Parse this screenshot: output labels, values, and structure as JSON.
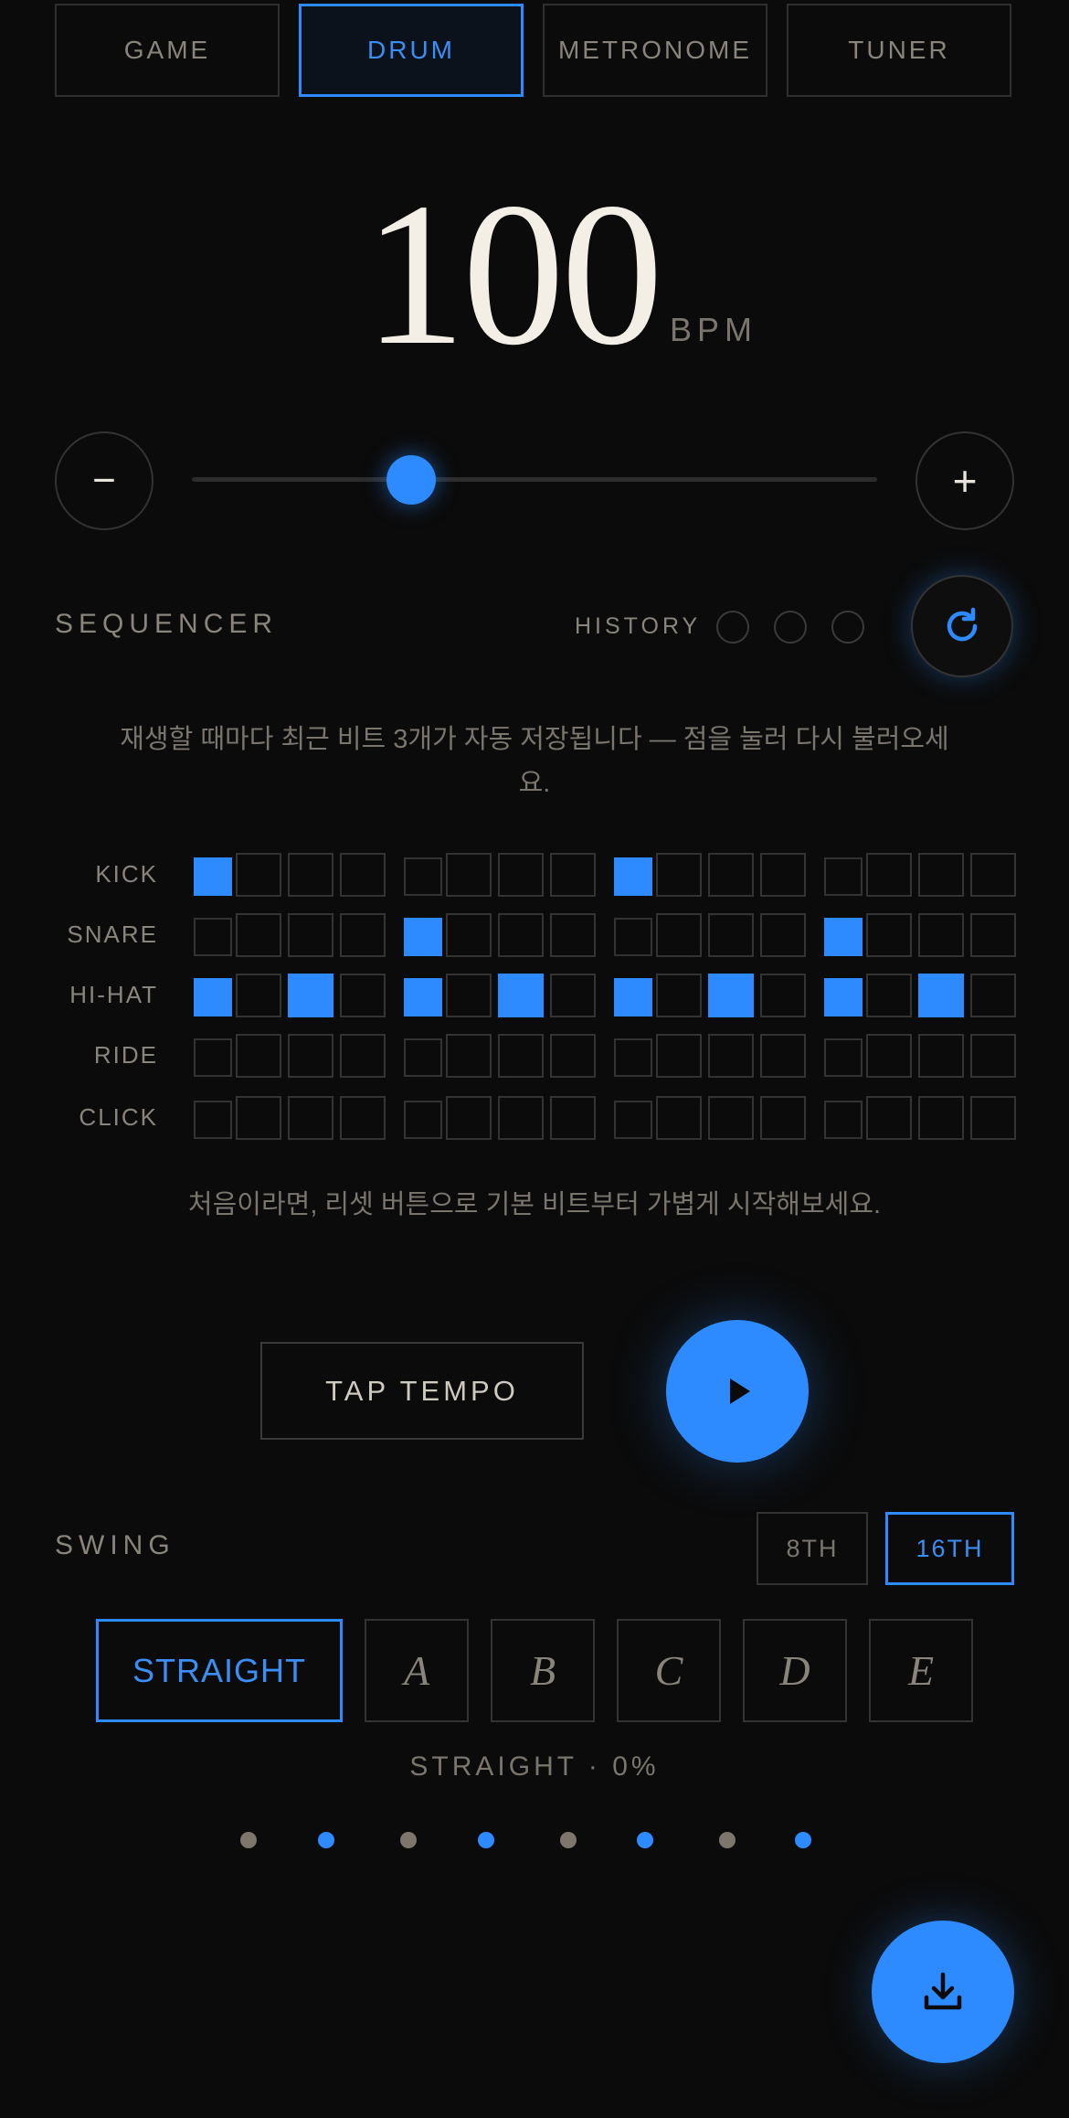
{
  "tabs": [
    {
      "label": "GAME",
      "active": false
    },
    {
      "label": "DRUM",
      "active": true
    },
    {
      "label": "METRONOME",
      "active": false
    },
    {
      "label": "TUNER",
      "active": false
    }
  ],
  "tempo": {
    "value": "100",
    "unit": "BPM",
    "slider_level": 0.32
  },
  "controls": {
    "minus_symbol": "−",
    "plus_symbol": "+"
  },
  "sequencer": {
    "title": "SEQUENCER",
    "history_label": "HISTORY",
    "history_slots": 3,
    "hint_top": "재생할 때마다 최근 비트 3개가 자동 저장됩니다 — 점을 눌러 다시 불러오세요.",
    "rows": [
      {
        "label": "KICK",
        "steps": [
          1,
          0,
          0,
          0,
          0,
          0,
          0,
          0,
          1,
          0,
          0,
          0,
          0,
          0,
          0,
          0
        ]
      },
      {
        "label": "SNARE",
        "steps": [
          0,
          0,
          0,
          0,
          1,
          0,
          0,
          0,
          0,
          0,
          0,
          0,
          1,
          0,
          0,
          0
        ]
      },
      {
        "label": "HI-HAT",
        "steps": [
          1,
          0,
          1,
          0,
          1,
          0,
          1,
          0,
          1,
          0,
          1,
          0,
          1,
          0,
          1,
          0
        ]
      },
      {
        "label": "RIDE",
        "steps": [
          0,
          0,
          0,
          0,
          0,
          0,
          0,
          0,
          0,
          0,
          0,
          0,
          0,
          0,
          0,
          0
        ]
      },
      {
        "label": "CLICK",
        "steps": [
          0,
          0,
          0,
          0,
          0,
          0,
          0,
          0,
          0,
          0,
          0,
          0,
          0,
          0,
          0,
          0
        ]
      }
    ],
    "hint_bottom": "처음이라면, 리셋 버튼으로 기본 비트부터 가볍게 시작해보세요."
  },
  "transport": {
    "tap_label": "TAP TEMPO",
    "play_icon": "play-icon"
  },
  "swing": {
    "title": "SWING",
    "resolutions": [
      {
        "label": "8TH",
        "active": false
      },
      {
        "label": "16TH",
        "active": true
      }
    ],
    "presets": [
      {
        "label": "STRAIGHT",
        "active": true
      },
      {
        "label": "A",
        "active": false
      },
      {
        "label": "B",
        "active": false
      },
      {
        "label": "C",
        "active": false
      },
      {
        "label": "D",
        "active": false
      },
      {
        "label": "E",
        "active": false
      }
    ],
    "status": "STRAIGHT · 0%",
    "beat_dots": [
      "gray",
      "blue",
      "gray",
      "blue",
      "gray",
      "blue",
      "gray",
      "blue"
    ]
  },
  "colors": {
    "accent": "#2e8bff",
    "background": "#0b0b0b",
    "muted": "#7a756d",
    "dot_gray": "#7d766c"
  },
  "fab": {
    "icon": "download-icon"
  }
}
